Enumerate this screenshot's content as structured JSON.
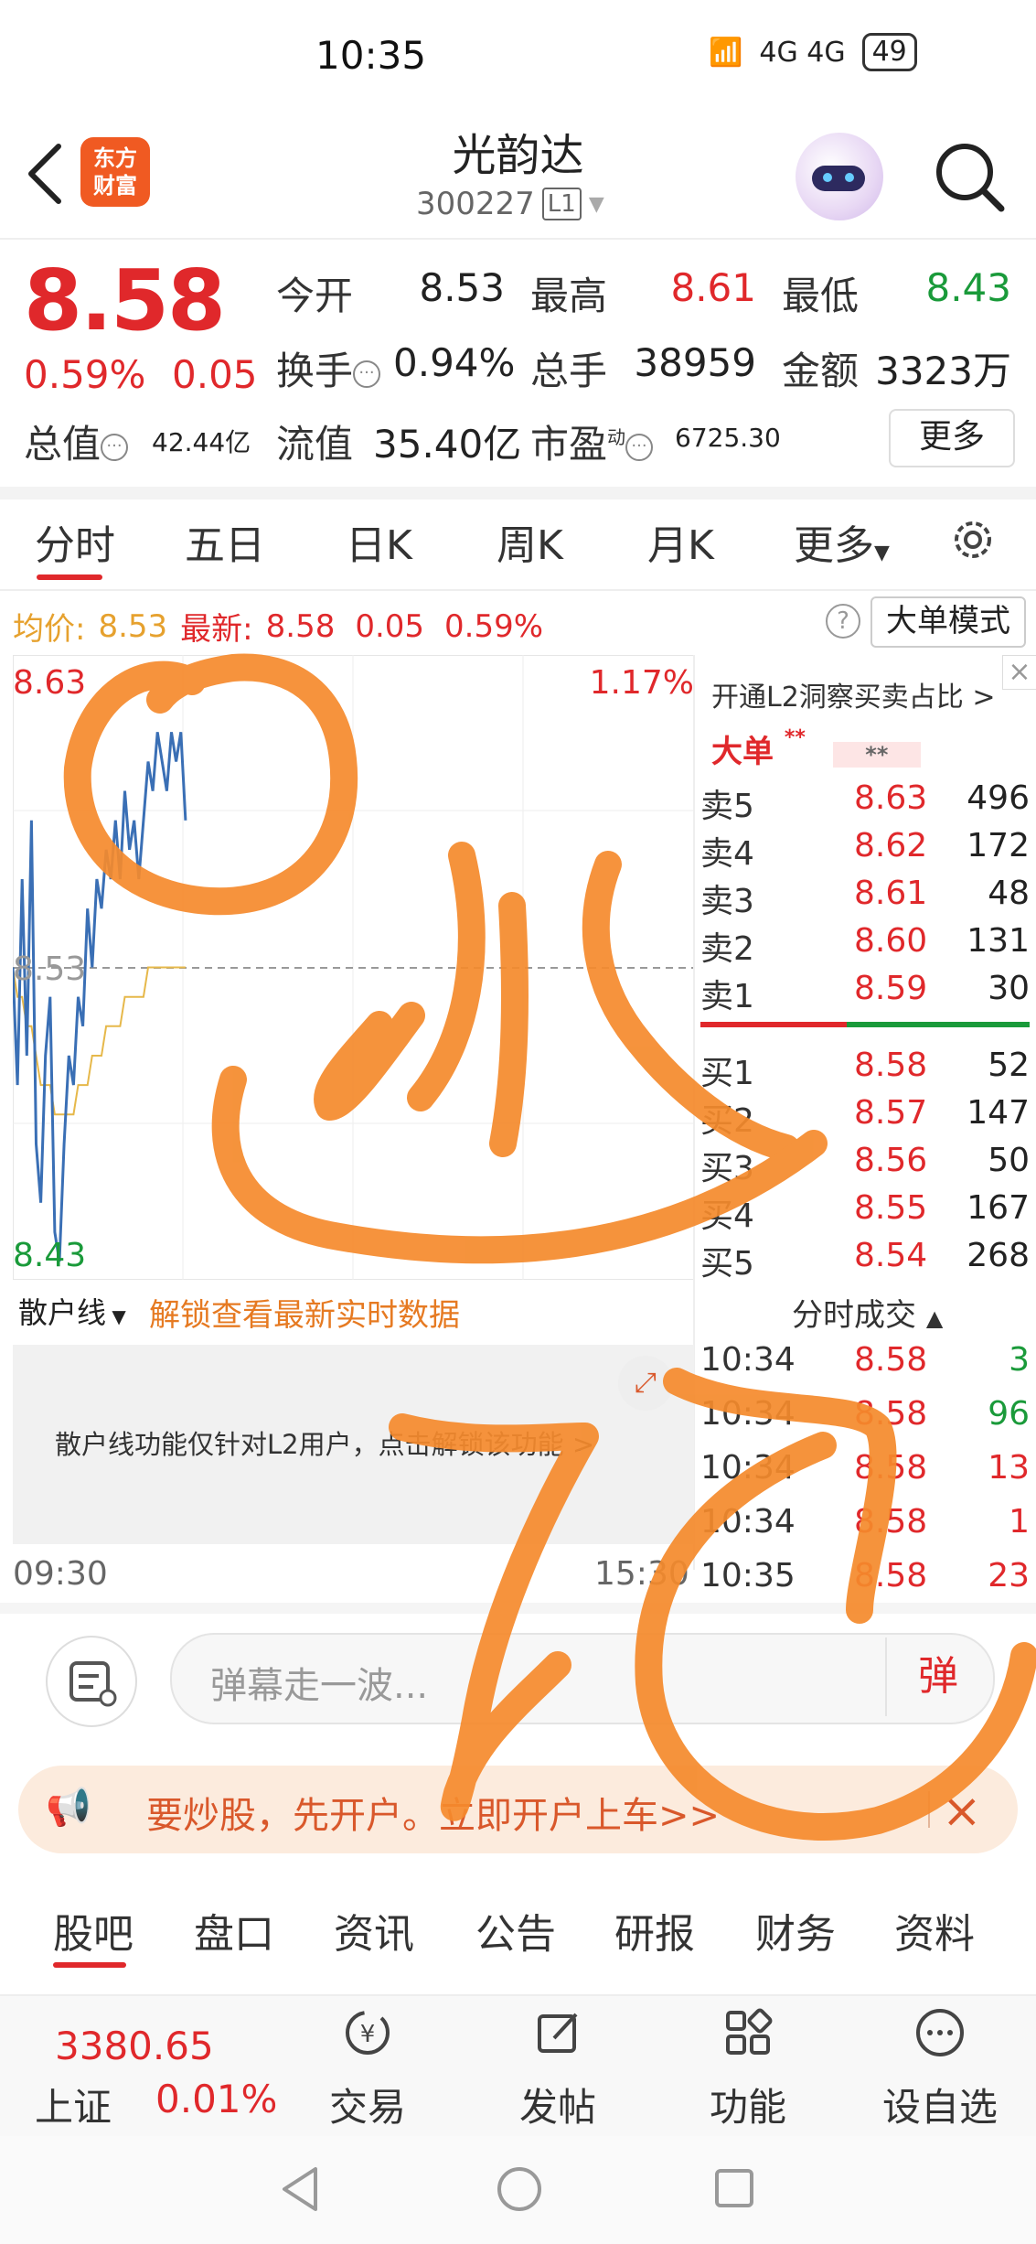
{
  "status_bar": {
    "time": "10:35",
    "signal": "4G 4G",
    "battery": "49"
  },
  "header": {
    "name": "光韵达",
    "code": "300227",
    "level_tag": "L1"
  },
  "quote": {
    "price": "8.58",
    "change_pct": "0.59%",
    "change_abs": "0.05",
    "open_label": "今开",
    "open": "8.53",
    "high_label": "最高",
    "high": "8.61",
    "low_label": "最低",
    "low": "8.43",
    "turnover_label": "换手",
    "turnover": "0.94%",
    "volume_label": "总手",
    "volume": "38959",
    "amount_label": "金额",
    "amount": "3323万",
    "total_mv_label": "总值",
    "total_mv": "42.44亿",
    "float_mv_label": "流值",
    "float_mv": "35.40亿",
    "pe_label": "市盈",
    "pe_sup": "动",
    "pe": "6725.30",
    "more_label": "更多"
  },
  "tabs": [
    "分时",
    "五日",
    "日K",
    "周K",
    "月K",
    "更多"
  ],
  "avg_row": {
    "avg_label": "均价:",
    "avg": "8.53",
    "latest_label": "最新:",
    "latest": "8.58",
    "chg": "0.05",
    "pct": "0.59%",
    "big_order_mode": "大单模式"
  },
  "chart_data": {
    "type": "line",
    "ylim": [
      8.43,
      8.63
    ],
    "y_ticks": [
      "8.63",
      "8.53",
      "8.43"
    ],
    "right_ticks": [
      "1.17%"
    ],
    "x_ticks": [
      "09:30",
      "15:30"
    ],
    "series": [
      {
        "name": "price",
        "color": "#3a6fb5",
        "values": [
          8.53,
          8.49,
          8.56,
          8.5,
          8.58,
          8.47,
          8.45,
          8.5,
          8.52,
          8.44,
          8.43,
          8.47,
          8.5,
          8.49,
          8.52,
          8.51,
          8.55,
          8.53,
          8.56,
          8.55,
          8.57,
          8.56,
          8.58,
          8.56,
          8.59,
          8.57,
          8.58,
          8.56,
          8.58,
          8.6,
          8.59,
          8.61,
          8.6,
          8.59,
          8.61,
          8.6,
          8.61,
          8.58
        ]
      },
      {
        "name": "avg",
        "color": "#e6b84a",
        "values": [
          8.53,
          8.52,
          8.52,
          8.51,
          8.51,
          8.5,
          8.49,
          8.49,
          8.49,
          8.48,
          8.48,
          8.48,
          8.48,
          8.48,
          8.49,
          8.49,
          8.49,
          8.5,
          8.5,
          8.5,
          8.51,
          8.51,
          8.51,
          8.51,
          8.52,
          8.52,
          8.52,
          8.52,
          8.52,
          8.53,
          8.53,
          8.53,
          8.53,
          8.53,
          8.53,
          8.53,
          8.53,
          8.53
        ]
      }
    ]
  },
  "order_book": {
    "l2_link": "开通L2洞察买卖占比 >",
    "big_order": "大单",
    "stars": "**",
    "sells": [
      {
        "label": "卖5",
        "price": "8.63",
        "vol": "496"
      },
      {
        "label": "卖4",
        "price": "8.62",
        "vol": "172"
      },
      {
        "label": "卖3",
        "price": "8.61",
        "vol": "48"
      },
      {
        "label": "卖2",
        "price": "8.60",
        "vol": "131"
      },
      {
        "label": "卖1",
        "price": "8.59",
        "vol": "30"
      }
    ],
    "buys": [
      {
        "label": "买1",
        "price": "8.58",
        "vol": "52"
      },
      {
        "label": "买2",
        "price": "8.57",
        "vol": "147"
      },
      {
        "label": "买3",
        "price": "8.56",
        "vol": "50"
      },
      {
        "label": "买4",
        "price": "8.55",
        "vol": "167"
      },
      {
        "label": "买5",
        "price": "8.54",
        "vol": "268"
      }
    ]
  },
  "ticks": {
    "title": "分时成交",
    "rows": [
      {
        "time": "10:34",
        "price": "8.58",
        "vol": "3",
        "color": "#1a9a3a"
      },
      {
        "time": "10:34",
        "price": "8.58",
        "vol": "96",
        "color": "#1a9a3a"
      },
      {
        "time": "10:34",
        "price": "8.58",
        "vol": "13",
        "color": "#e0282b"
      },
      {
        "time": "10:34",
        "price": "8.58",
        "vol": "1",
        "color": "#e0282b"
      },
      {
        "time": "10:35",
        "price": "8.58",
        "vol": "23",
        "color": "#e0282b"
      }
    ]
  },
  "retail": {
    "selector": "散户线",
    "unlock": "解锁查看最新实时数据",
    "notice": "散户线功能仅针对L2用户，点击解锁该功能 >"
  },
  "time_axis": {
    "start": "09:30",
    "end": "15:30"
  },
  "danmaku": {
    "placeholder": "弹幕走一波...",
    "button": "弹"
  },
  "banner": {
    "text": "要炒股，先开户。立即开户上车>>"
  },
  "bottom_tabs": [
    "股吧",
    "盘口",
    "资讯",
    "公告",
    "研报",
    "财务",
    "资料"
  ],
  "nav": {
    "index_value": "3380.65",
    "index_name": "上证",
    "index_change": "0.01%",
    "items": [
      "交易",
      "发帖",
      "功能",
      "设自选"
    ]
  },
  "colors": {
    "up": "#e0282b",
    "down": "#1a9a3a",
    "accent": "#f05a22",
    "scribble": "#f58a2c"
  }
}
